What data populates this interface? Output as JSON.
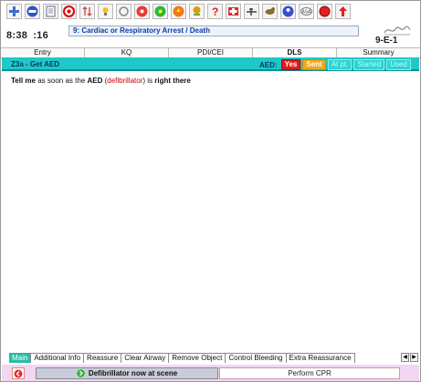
{
  "toolbar": {
    "icons": [
      "add-icon",
      "remove-icon",
      "document-icon",
      "stop-icon",
      "sort-icon",
      "hint-icon",
      "refresh-icon",
      "radiation-icon",
      "hazard-icon",
      "fire-icon",
      "poison-icon",
      "question-icon",
      "medical-icon",
      "aircraft-icon",
      "animal-icon",
      "user-icon",
      "asa-icon",
      "alert-icon",
      "up-arrow-icon"
    ],
    "asa_label": "ASA"
  },
  "time": {
    "main": "8:38",
    "sub": ":16"
  },
  "case": {
    "title": "9:  Cardiac or Respiratory Arrest / Death"
  },
  "code": "9-E-1",
  "tabs": {
    "entry": "Entry",
    "kq": "KQ",
    "pdi": "PDI/CEI",
    "dls": "DLS",
    "summary": "Summary"
  },
  "header": {
    "title": "Z3a - Get AED",
    "aed_label": "AED:",
    "options": {
      "yes": "Yes",
      "sent": "Sent",
      "at_pt": "At pt.",
      "started": "Started",
      "used": "Used"
    }
  },
  "instruction": {
    "tell_me": "Tell me",
    "p1": " as soon as the ",
    "aed": "AED",
    "p2": " (",
    "defib": "defibrillator",
    "p3": ") is ",
    "right_there": "right there"
  },
  "bottom_tabs": {
    "main": "Main",
    "additional": "Additional Info",
    "reassure": "Reassure",
    "airway": "Clear Airway",
    "remove": "Remove Object",
    "bleeding": "Control Bleeding",
    "extra": "Extra Reassurance"
  },
  "actions": {
    "primary": "Defibrillator now at scene",
    "secondary": "Perform CPR"
  },
  "colors": {
    "header": "#1ec8c8",
    "yes": "#e21b1b",
    "sent": "#f2a716",
    "action_bar": "#f3d6f0"
  }
}
